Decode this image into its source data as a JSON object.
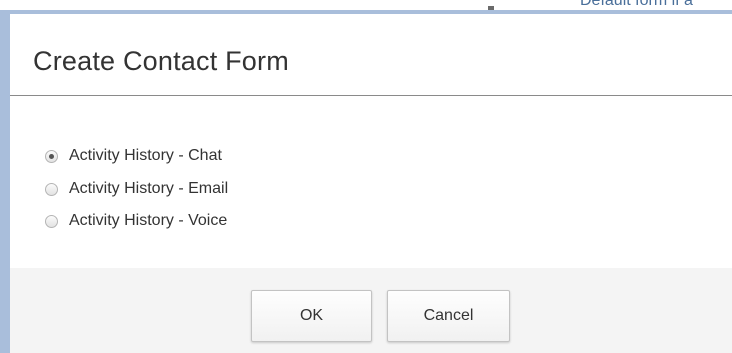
{
  "background": {
    "partial_text": "Default form if a"
  },
  "dialog": {
    "title": "Create Contact Form",
    "options": [
      {
        "label": "Activity History - Chat",
        "selected": true
      },
      {
        "label": "Activity History - Email",
        "selected": false
      },
      {
        "label": "Activity History - Voice",
        "selected": false
      }
    ],
    "ok_label": "OK",
    "cancel_label": "Cancel"
  },
  "colors": {
    "accent_border": "#a9bedb",
    "footer_bg": "#f4f4f4",
    "text": "#333333"
  }
}
